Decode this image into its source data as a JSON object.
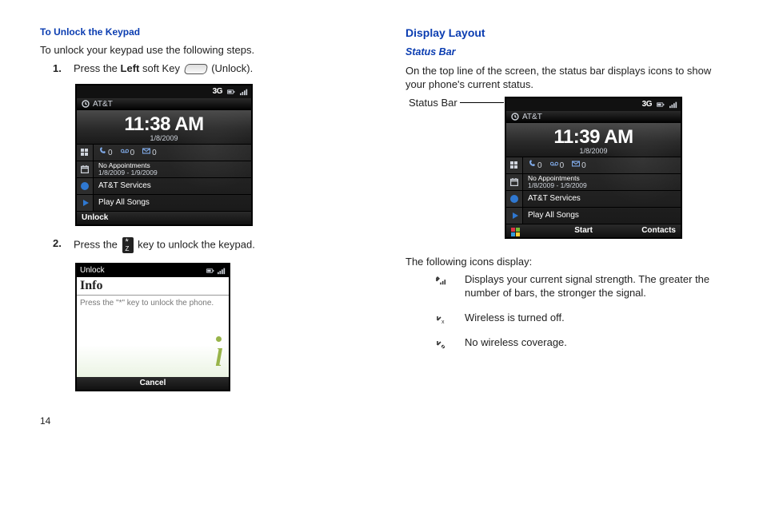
{
  "left": {
    "h": "To Unlock the Keypad",
    "intro": "To unlock your keypad use the following steps.",
    "step1_a": "Press the ",
    "step1_b": "Left",
    "step1_c": " soft Key ",
    "step1_d": " (Unlock).",
    "step2_a": "Press the ",
    "step2_b": " key to unlock the keypad.",
    "num1": "1.",
    "num2": "2."
  },
  "shot1": {
    "sb_3g": "3G",
    "carrier": "AT&T",
    "time": "11:38 AM",
    "date": "1/8/2009",
    "counts0": "0",
    "appt_line1": "No Appointments",
    "appt_line2": "1/8/2009 - 1/9/2009",
    "services": "AT&T Services",
    "play": "Play All Songs",
    "footer_left": "Unlock"
  },
  "shot2": {
    "sb_3g": "3G",
    "carrier": "AT&T",
    "time": "11:39 AM",
    "date": "1/8/2009",
    "counts0": "0",
    "appt_line1": "No Appointments",
    "appt_line2": "1/8/2009 - 1/9/2009",
    "services": "AT&T Services",
    "play": "Play All Songs",
    "footer_center": "Start",
    "footer_right": "Contacts"
  },
  "shot3": {
    "top_left": "Unlock",
    "title": "Info",
    "msg": "Press the \"*\" key to unlock the phone.",
    "footer": "Cancel"
  },
  "right": {
    "h1": "Display Layout",
    "h2": "Status Bar",
    "para": "On the top line of the screen, the status bar displays icons to show your phone's current status.",
    "label": "Status Bar",
    "icons_intro": "The following icons display:",
    "icon1": "Displays your current signal strength. The greater the number of bars, the stronger the signal.",
    "icon2": "Wireless is turned off.",
    "icon3": "No wireless coverage."
  },
  "page": "14"
}
